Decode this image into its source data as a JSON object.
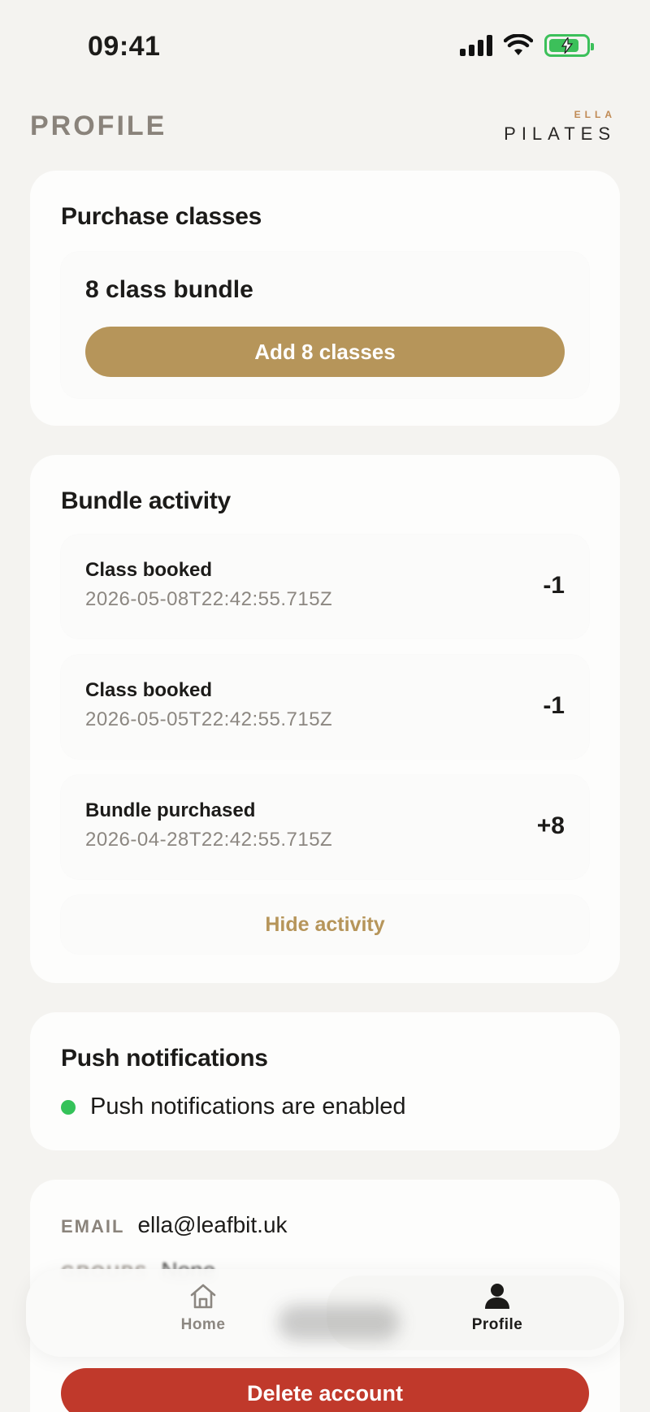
{
  "status_bar": {
    "time": "09:41"
  },
  "header": {
    "title": "PROFILE",
    "brand_small": "ELLA",
    "brand_large": "PILATES"
  },
  "purchase": {
    "title": "Purchase classes",
    "bundle_name": "8 class bundle",
    "button_label": "Add 8 classes",
    "accent_color": "#b6955a"
  },
  "activity": {
    "title": "Bundle activity",
    "items": [
      {
        "label": "Class booked",
        "timestamp": "2026-05-08T22:42:55.715Z",
        "delta": "-1"
      },
      {
        "label": "Class booked",
        "timestamp": "2026-05-05T22:42:55.715Z",
        "delta": "-1"
      },
      {
        "label": "Bundle purchased",
        "timestamp": "2026-04-28T22:42:55.715Z",
        "delta": "+8"
      }
    ],
    "toggle_label": "Hide activity"
  },
  "push": {
    "title": "Push notifications",
    "status_text": "Push notifications are enabled",
    "status_color": "#34c259"
  },
  "account": {
    "email_label": "EMAIL",
    "email_value": "ella@leafbit.uk",
    "groups_label": "GROUPS",
    "groups_value": "None"
  },
  "tab_bar": {
    "home_label": "Home",
    "home_icon": "home-icon",
    "profile_label": "Profile",
    "profile_icon": "person-icon",
    "active": "Profile"
  },
  "delete_button_label": "Delete account",
  "delete_color": "#c0392b"
}
